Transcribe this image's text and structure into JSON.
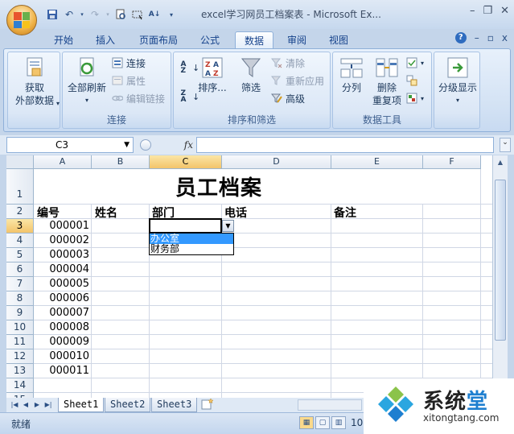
{
  "window": {
    "title": "excel学习网员工档案表 - Microsoft Ex...",
    "minimize": "–",
    "restore": "❐",
    "close": "✕",
    "ribbon_min": "–",
    "ribbon_restore": "▫",
    "ribbon_close": "x",
    "help": "?"
  },
  "tabs": [
    "开始",
    "插入",
    "页面布局",
    "公式",
    "数据",
    "审阅",
    "视图"
  ],
  "active_tab": "数据",
  "ribbon": {
    "group_external": {
      "label": "",
      "button": "获取\n外部数据"
    },
    "group_connections": {
      "label": "连接",
      "refresh_all": "全部刷新",
      "connections": "连接",
      "properties": "属性",
      "edit_links": "编辑链接"
    },
    "group_sort": {
      "label": "排序和筛选",
      "sort": "排序...",
      "filter": "筛选",
      "clear": "清除",
      "reapply": "重新应用",
      "advanced": "高级"
    },
    "group_tools": {
      "label": "数据工具",
      "text_to_columns": "分列",
      "remove_duplicates": "删除\n重复项"
    },
    "group_outline": {
      "button": "分级显示"
    }
  },
  "formula_bar": {
    "name_box": "C3",
    "fx": "fx",
    "formula": ""
  },
  "columns": [
    "A",
    "B",
    "C",
    "D",
    "E",
    "F"
  ],
  "rows": [
    "1",
    "2",
    "3",
    "4",
    "5",
    "6",
    "7",
    "8",
    "9",
    "10",
    "11",
    "12",
    "13",
    "14",
    "15"
  ],
  "sheet": {
    "title": "员工档案",
    "headers": [
      "编号",
      "姓名",
      "部门",
      "电话",
      "备注"
    ],
    "ids": [
      "000001",
      "000002",
      "000003",
      "000004",
      "000005",
      "000006",
      "000007",
      "000008",
      "000009",
      "000010",
      "000011"
    ]
  },
  "active_cell": "C3",
  "dropdown": {
    "options": [
      "办公室",
      "财务部"
    ],
    "highlighted": "办公室"
  },
  "sheet_tabs": [
    "Sheet1",
    "Sheet2",
    "Sheet3"
  ],
  "active_sheet": "Sheet1",
  "status": {
    "text": "就绪",
    "zoom": "10"
  },
  "watermark": {
    "cn_part1": "系统",
    "cn_part2": "堂",
    "en": "xitongtang.com"
  }
}
